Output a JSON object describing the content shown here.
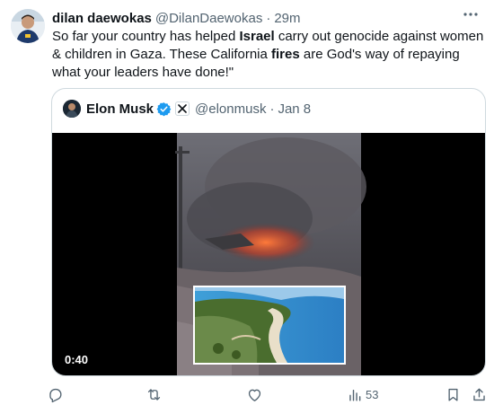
{
  "tweet": {
    "author_name": "dilan daewokas",
    "author_handle": "@DilanDaewokas",
    "separator": "·",
    "time": "29m",
    "text_parts": {
      "p1": "So far your country has helped ",
      "b1": "Israel",
      "p2": " carry out genocide against women & children in Gaza. These California ",
      "b2": "fires",
      "p3": " are God's way of repaying what your leaders have done!\""
    }
  },
  "quoted": {
    "author_name": "Elon Musk",
    "author_handle": "@elonmusk",
    "separator": "·",
    "date": "Jan 8",
    "video_duration": "0:40"
  },
  "actions": {
    "reply_icon": "reply-icon",
    "retweet_icon": "retweet-icon",
    "like_icon": "like-icon",
    "views_icon": "views-icon",
    "views_count": "53",
    "bookmark_icon": "bookmark-icon",
    "share_icon": "share-icon"
  },
  "colors": {
    "text": "#0f1419",
    "secondary": "#536471",
    "border": "#cfd9de",
    "verified": "#1d9bf0"
  }
}
